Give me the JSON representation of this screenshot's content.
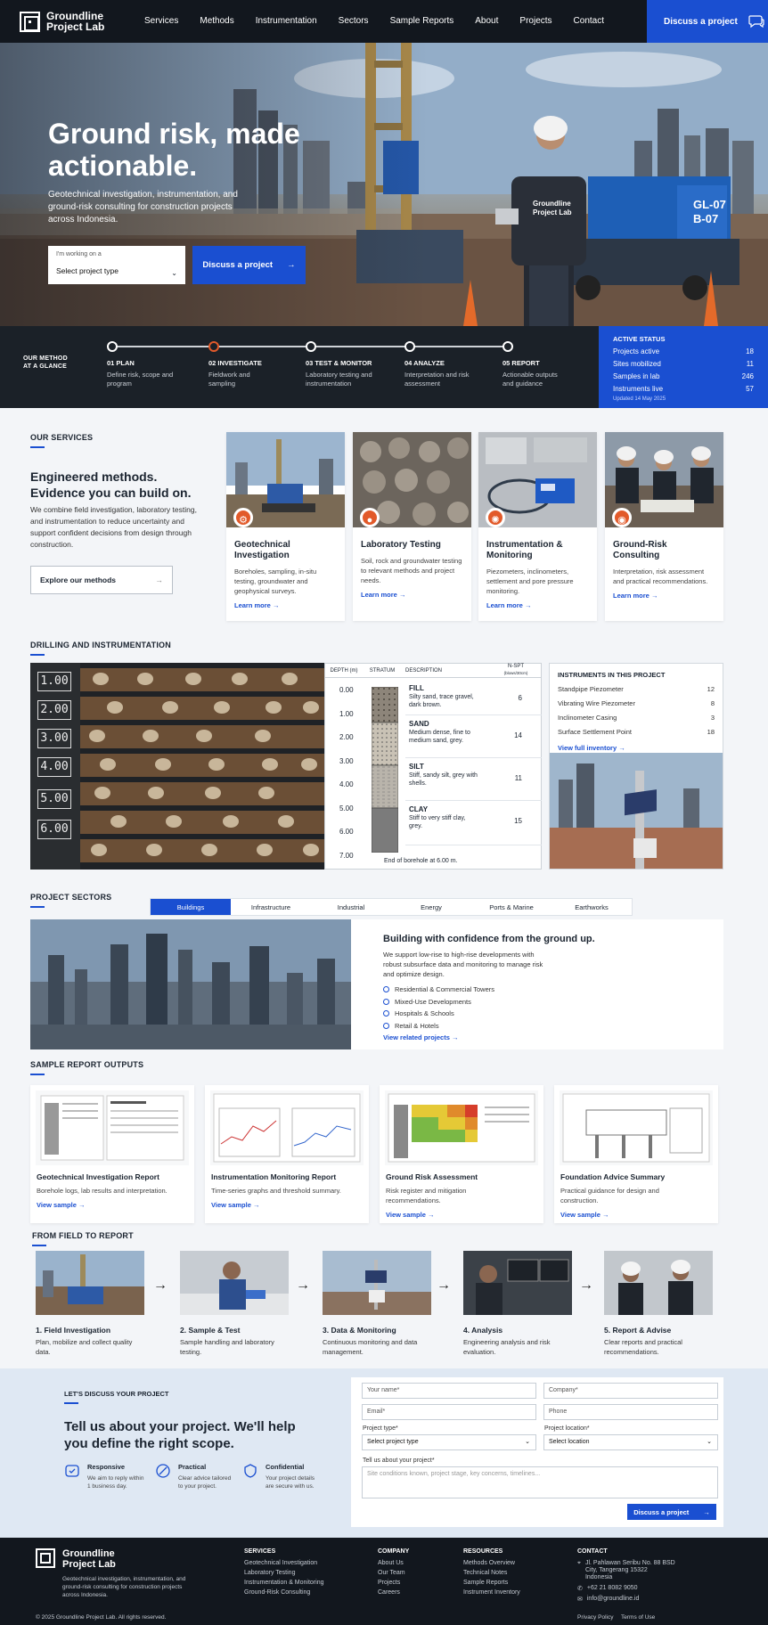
{
  "nav": {
    "brand_line1": "Groundline",
    "brand_line2": "Project Lab",
    "links": [
      "Services",
      "Methods",
      "Instrumentation",
      "Sectors",
      "Sample Reports",
      "About",
      "Projects",
      "Contact"
    ],
    "cta": "Discuss a project"
  },
  "hero": {
    "title": "Ground risk, made actionable.",
    "subtitle": "Geotechnical investigation, instrumentation, and ground-risk consulting for construction projects across Indonesia.",
    "select_label": "I'm working on a",
    "select_value": "Select project type",
    "button": "Discuss a project",
    "jacket_text": "Groundline Project Lab",
    "rig_text1": "GL-07",
    "rig_text2": "B-07"
  },
  "method": {
    "label_line1": "OUR METHOD",
    "label_line2": "AT A GLANCE",
    "steps": [
      {
        "title": "01 PLAN",
        "desc": "Define risk, scope and program"
      },
      {
        "title": "02 INVESTIGATE",
        "desc": "Fieldwork and sampling"
      },
      {
        "title": "03 TEST & MONITOR",
        "desc": "Laboratory testing and instrumentation"
      },
      {
        "title": "04 ANALYZE",
        "desc": "Interpretation and risk assessment"
      },
      {
        "title": "05 REPORT",
        "desc": "Actionable outputs and guidance"
      }
    ],
    "active_step": 2
  },
  "status": {
    "title": "ACTIVE STATUS",
    "rows": [
      {
        "label": "Projects active",
        "value": "18"
      },
      {
        "label": "Sites mobilized",
        "value": "11"
      },
      {
        "label": "Samples in lab",
        "value": "246"
      },
      {
        "label": "Instruments live",
        "value": "57"
      }
    ],
    "updated": "Updated 14 May 2025"
  },
  "services": {
    "section": "OUR SERVICES",
    "heading": "Engineered methods. Evidence you can build on.",
    "description": "We combine field investigation, laboratory testing, and instrumentation to reduce uncertainty and support confident decisions from design through construction.",
    "button": "Explore our methods",
    "cards": [
      {
        "title": "Geotechnical Investigation",
        "desc": "Boreholes, sampling, in-situ testing, groundwater and geophysical surveys.",
        "link": "Learn more"
      },
      {
        "title": "Laboratory Testing",
        "desc": "Soil, rock and groundwater testing to relevant methods and project needs.",
        "link": "Learn more"
      },
      {
        "title": "Instrumentation & Monitoring",
        "desc": "Piezometers, inclinometers, settlement and pore pressure monitoring.",
        "link": "Learn more"
      },
      {
        "title": "Ground-Risk Consulting",
        "desc": "Interpretation, risk assessment and practical recommendations.",
        "link": "Learn more"
      }
    ]
  },
  "drilling": {
    "section": "DRILLING AND INSTRUMENTATION",
    "core_labels": [
      "1.00",
      "2.00",
      "3.00",
      "4.00",
      "5.00",
      "6.00"
    ],
    "log_headers": {
      "depth": "DEPTH (m)",
      "stratum": "STRATUM",
      "description": "DESCRIPTION",
      "nspt": "N-SPT",
      "nspt_unit": "(blows/30cm)"
    },
    "depths": [
      "0.00",
      "1.00",
      "2.00",
      "3.00",
      "4.00",
      "5.00",
      "6.00",
      "7.00"
    ],
    "layers": [
      {
        "name": "FILL",
        "desc": "Silty sand, trace gravel, dark brown.",
        "n": "6"
      },
      {
        "name": "SAND",
        "desc": "Medium dense, fine to medium sand, grey.",
        "n": "14"
      },
      {
        "name": "SILT",
        "desc": "Stiff, sandy silt, grey with shells.",
        "n": "11"
      },
      {
        "name": "CLAY",
        "desc": "Stiff to very stiff clay, grey.",
        "n": "15"
      }
    ],
    "end_note": "End of borehole at 6.00 m.",
    "instruments_title": "INSTRUMENTS IN THIS PROJECT",
    "instruments": [
      {
        "name": "Standpipe Piezometer",
        "count": "12"
      },
      {
        "name": "Vibrating Wire Piezometer",
        "count": "8"
      },
      {
        "name": "Inclinometer Casing",
        "count": "3"
      },
      {
        "name": "Surface Settlement Point",
        "count": "18"
      }
    ],
    "instruments_link": "View full inventory"
  },
  "sectors": {
    "section": "PROJECT SECTORS",
    "tabs": [
      "Buildings",
      "Infrastructure",
      "Industrial",
      "Energy",
      "Ports & Marine",
      "Earthworks"
    ],
    "active_tab": 0,
    "title": "Building with confidence from the ground up.",
    "desc": "We support low-rise to high-rise developments with robust subsurface data and monitoring to manage risk and optimize design.",
    "items": [
      "Residential & Commercial Towers",
      "Mixed-Use Developments",
      "Hospitals & Schools",
      "Retail & Hotels"
    ],
    "link": "View related projects"
  },
  "reports": {
    "section": "SAMPLE REPORT OUTPUTS",
    "items": [
      {
        "title": "Geotechnical Investigation Report",
        "desc": "Borehole logs, lab results and interpretation.",
        "link": "View sample"
      },
      {
        "title": "Instrumentation Monitoring Report",
        "desc": "Time-series graphs and threshold summary.",
        "link": "View sample"
      },
      {
        "title": "Ground Risk Assessment",
        "desc": "Risk register and mitigation recommendations.",
        "link": "View sample"
      },
      {
        "title": "Foundation Advice Summary",
        "desc": "Practical guidance for design and construction.",
        "link": "View sample"
      }
    ]
  },
  "field": {
    "section": "FROM FIELD TO REPORT",
    "steps": [
      {
        "title": "1. Field Investigation",
        "desc": "Plan, mobilize and collect quality data."
      },
      {
        "title": "2. Sample & Test",
        "desc": "Sample handling and laboratory testing."
      },
      {
        "title": "3. Data & Monitoring",
        "desc": "Continuous monitoring and data management."
      },
      {
        "title": "4. Analysis",
        "desc": "Engineering analysis and risk evaluation."
      },
      {
        "title": "5. Report & Advise",
        "desc": "Clear reports and practical recommendations."
      }
    ]
  },
  "contact": {
    "label": "LET'S DISCUSS YOUR PROJECT",
    "title": "Tell us about your project. We'll help you define the right scope.",
    "features": [
      {
        "title": "Responsive",
        "desc": "We aim to reply within 1 business day."
      },
      {
        "title": "Practical",
        "desc": "Clear advice tailored to your project."
      },
      {
        "title": "Confidential",
        "desc": "Your project details are secure with us."
      }
    ],
    "form": {
      "name_ph": "Your name*",
      "company_ph": "Company*",
      "email_ph": "Email*",
      "phone_ph": "Phone",
      "type_label": "Project type*",
      "type_value": "Select project type",
      "location_label": "Project location*",
      "location_value": "Select location",
      "message_label": "Tell us about your project*",
      "message_ph": "Site conditions known, project stage, key concerns, timelines...",
      "submit": "Discuss a project"
    }
  },
  "footer": {
    "brand_line1": "Groundline",
    "brand_line2": "Project Lab",
    "about": "Geotechnical investigation, instrumentation, and ground-risk consulting for construction projects across Indonesia.",
    "columns": [
      {
        "title": "SERVICES",
        "items": [
          "Geotechnical Investigation",
          "Laboratory Testing",
          "Instrumentation & Monitoring",
          "Ground-Risk Consulting"
        ]
      },
      {
        "title": "COMPANY",
        "items": [
          "About Us",
          "Our Team",
          "Projects",
          "Careers"
        ]
      },
      {
        "title": "RESOURCES",
        "items": [
          "Methods Overview",
          "Technical Notes",
          "Sample Reports",
          "Instrument Inventory"
        ]
      }
    ],
    "contact_title": "CONTACT",
    "address": "Jl. Pahlawan Seribu No. 88 BSD City, Tangerang 15322 Indonesia",
    "phone": "+62 21 8082 9050",
    "email": "info@groundline.id",
    "copyright": "© 2025 Groundline Project Lab. All rights reserved.",
    "privacy": "Privacy Policy",
    "terms": "Terms of Use"
  },
  "colors": {
    "accent": "#1a4fd1",
    "orange": "#e25a2a",
    "dark": "#12171e"
  }
}
